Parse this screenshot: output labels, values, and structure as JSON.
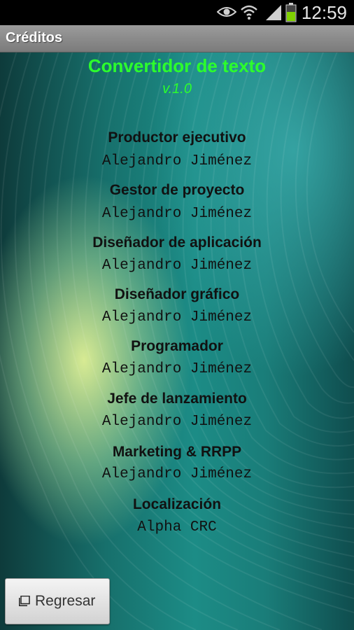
{
  "status_bar": {
    "time": "12:59",
    "icons": [
      "eye-icon",
      "wifi-icon",
      "signal-icon",
      "battery-icon"
    ]
  },
  "action_bar": {
    "title": "Créditos"
  },
  "header": {
    "app_name": "Convertidor de texto",
    "version": "v.1.0"
  },
  "credits": [
    {
      "role": "Productor ejecutivo",
      "name": "Alejandro Jiménez"
    },
    {
      "role": "Gestor de proyecto",
      "name": "Alejandro Jiménez"
    },
    {
      "role": "Diseñador de aplicación",
      "name": "Alejandro Jiménez"
    },
    {
      "role": "Diseñador gráfico",
      "name": "Alejandro Jiménez"
    },
    {
      "role": "Programador",
      "name": "Alejandro Jiménez"
    },
    {
      "role": "Jefe de lanzamiento",
      "name": "Alejandro Jiménez"
    },
    {
      "role": "Marketing & RRPP",
      "name": "Alejandro Jiménez"
    },
    {
      "role": "Localización",
      "name": "Alpha CRC"
    }
  ],
  "back_button": {
    "label": "Regresar",
    "icon": "back-square-icon"
  },
  "colors": {
    "title_green": "#2cff2c",
    "action_bar": "#8a8a8a",
    "teal": "#1c8c86"
  }
}
